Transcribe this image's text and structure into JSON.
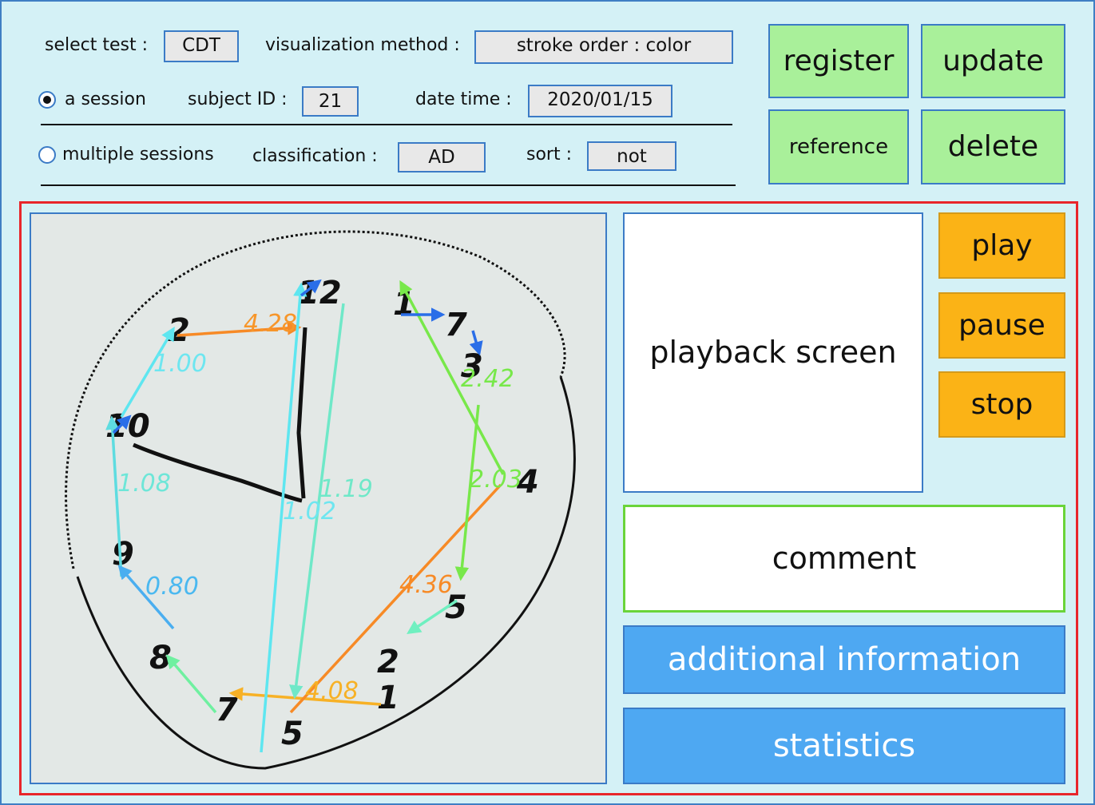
{
  "header": {
    "select_test_label": "select test :",
    "select_test_value": "CDT",
    "visualization_label": "visualization method :",
    "visualization_value": "stroke order : color",
    "session_mode": "a session",
    "a_session_label": "a session",
    "subject_id_label": "subject ID :",
    "subject_id_value": "21",
    "date_time_label": "date time :",
    "date_time_value": "2020/01/15",
    "multiple_sessions_label": "multiple sessions",
    "classification_label": "classification :",
    "classification_value": "AD",
    "sort_label": "sort :",
    "sort_value": "not"
  },
  "actions": {
    "register": "register",
    "update": "update",
    "reference": "reference",
    "delete": "delete"
  },
  "playback": {
    "screen_label": "playback screen",
    "play": "play",
    "pause": "pause",
    "stop": "stop"
  },
  "comment_label": "comment",
  "additional_information": "additional information",
  "statistics": "statistics",
  "drawing": {
    "interval_labels": [
      "4.28",
      "1.00",
      "1.08",
      "0.80",
      "4.08",
      "4.36",
      "2.03",
      "2.42",
      "1.02",
      "1.19"
    ],
    "stroke_colors": {
      "black": "#111111",
      "cyan": "#5ee6f0",
      "aqua_green": "#6ff0c0",
      "green": "#78e84a",
      "orange": "#f78a26",
      "yellow_orange": "#f7b126",
      "blue": "#2a6ee8",
      "light_blue": "#4aaef0"
    }
  },
  "colors": {
    "background": "#d4f1f6",
    "green_button": "#a9f09a",
    "orange_button": "#fbb316",
    "blue_button": "#4ea8f2",
    "frame_red": "#e8262b",
    "border_blue": "#3b7bc6"
  }
}
